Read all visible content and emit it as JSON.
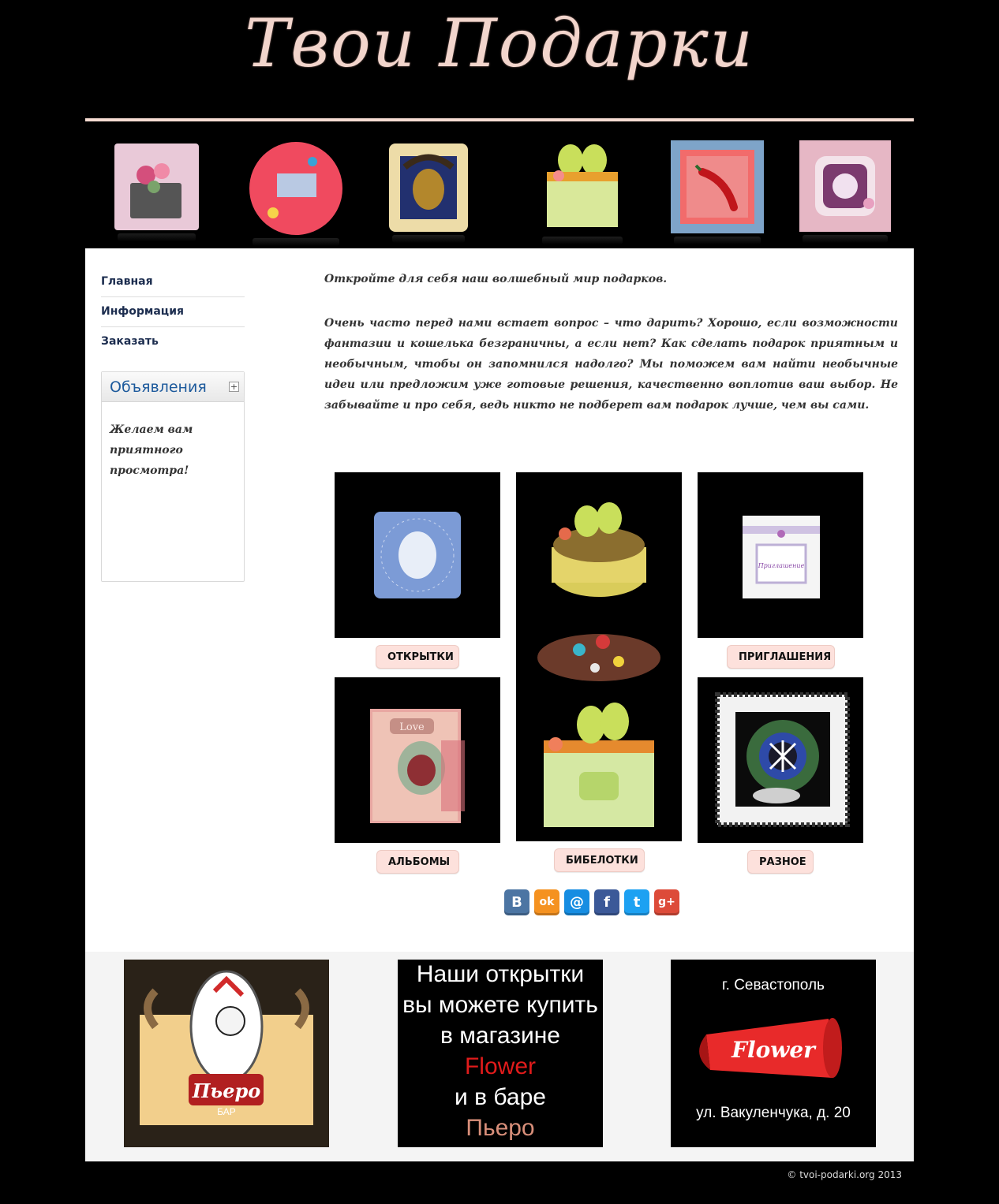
{
  "header": {
    "logo_text": "Твои Подарки"
  },
  "banner": {
    "items": [
      "card-flowers-icon",
      "round-card-icon",
      "mask-card-icon",
      "box-eggs-icon",
      "pepper-card-icon",
      "lace-card-icon"
    ]
  },
  "nav": {
    "items": [
      {
        "label": "Главная"
      },
      {
        "label": "Информация"
      },
      {
        "label": "Заказать"
      }
    ]
  },
  "ads": {
    "title": "Объявления",
    "toggle": "+",
    "text": "Желаем вам приятного просмотра!"
  },
  "article": {
    "intro": "Откройте для себя наш волшебный мир подарков.",
    "body": "Очень часто перед нами встает вопрос – что дарить? Хорошо, если возможности фантазии и кошелька безграничны, а если нет? Как сделать подарок приятным и необычным, чтобы он запомнился надолго? Мы поможем вам найти необычные идеи или предложим уже готовые решения, качественно воплотив ваш выбор. Не забывайте и про себя, ведь никто не подберет вам подарок лучше, чем вы сами."
  },
  "gallery": {
    "cards_label": "ОТКРЫТКИ",
    "invitations_label": "ПРИГЛАШЕНИЯ",
    "albums_label": "АЛЬБОМЫ",
    "trinkets_label": "БИБЕЛОТКИ",
    "misc_label": "РАЗНОЕ",
    "invitation_card_text": "Приглашение",
    "album_text": "Love"
  },
  "social": {
    "vk": "B",
    "ok": "ok",
    "mail": "@",
    "facebook": "f",
    "twitter": "t",
    "gplus": "g+"
  },
  "footer_banners": {
    "bar_name": "Пьеро",
    "bar_sub": "БАР",
    "shop_lines": [
      "Наши открытки",
      "вы можете купить",
      "в магазине",
      "Flower",
      "и в баре",
      "Пьеро"
    ],
    "city": "г. Севастополь",
    "flower_logo": "Flower",
    "address": "ул. Вакуленчука, д. 20"
  },
  "copyright": "© tvoi-podarki.org 2013",
  "colors": {
    "background": "#000000",
    "accent_pink": "#fde1dc",
    "nav_text": "#1c2d4f",
    "ads_title": "#1d5a9c"
  }
}
